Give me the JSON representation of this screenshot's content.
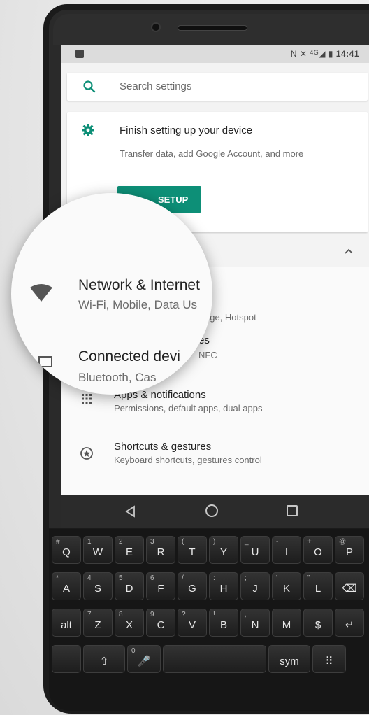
{
  "status_bar": {
    "icons": [
      "image-icon",
      "nfc-icon",
      "vibrate-icon",
      "signal-icon",
      "battery-icon"
    ],
    "network": "4G",
    "time": "14:41"
  },
  "search": {
    "placeholder": "Search settings"
  },
  "setup_card": {
    "title": "Finish setting up your device",
    "subtitle": "Transfer data, add Google Account, and more",
    "button_label": "SETUP"
  },
  "settings_items": [
    {
      "title": "Network & Internet",
      "subtitle": "Wi-Fi, Mobile, Data Usage, Hotspot",
      "visible_subtitle_tail": "age, Hotspot",
      "icon": "wifi-icon"
    },
    {
      "title": "Connected devices",
      "visible_title_tail": "es",
      "visible_subtitle_tail": "NFC",
      "icon": "devices-icon"
    },
    {
      "title": "Apps & notifications",
      "subtitle": "Permissions, default apps, dual apps",
      "icon": "apps-grid-icon"
    },
    {
      "title": "Shortcuts & gestures",
      "subtitle": "Keyboard shortcuts, gestures control",
      "icon": "shortcuts-icon"
    }
  ],
  "magnifier": {
    "title1": "Network & Internet",
    "sub1": "Wi-Fi, Mobile, Data Us",
    "title2": "Connected devi",
    "sub2": "Bluetooth, Cas"
  },
  "nav_bar": {
    "icons": [
      "back-icon",
      "home-icon",
      "recents-icon"
    ]
  },
  "keyboard": {
    "row1": [
      {
        "main": "Q",
        "alt": "#"
      },
      {
        "main": "W",
        "alt": "1"
      },
      {
        "main": "E",
        "alt": "2"
      },
      {
        "main": "R",
        "alt": "3"
      },
      {
        "main": "T",
        "alt": "("
      },
      {
        "main": "Y",
        "alt": ")"
      },
      {
        "main": "U",
        "alt": "_"
      },
      {
        "main": "I",
        "alt": "-"
      },
      {
        "main": "O",
        "alt": "+"
      },
      {
        "main": "P",
        "alt": "@"
      }
    ],
    "row2": [
      {
        "main": "A",
        "alt": "*"
      },
      {
        "main": "S",
        "alt": "4"
      },
      {
        "main": "D",
        "alt": "5"
      },
      {
        "main": "F",
        "alt": "6"
      },
      {
        "main": "G",
        "alt": "/"
      },
      {
        "main": "H",
        "alt": ":"
      },
      {
        "main": "J",
        "alt": ";"
      },
      {
        "main": "K",
        "alt": "'"
      },
      {
        "main": "L",
        "alt": "\""
      },
      {
        "main": "⌫",
        "alt": ""
      }
    ],
    "row3": [
      {
        "main": "alt",
        "alt": ""
      },
      {
        "main": "Z",
        "alt": "7"
      },
      {
        "main": "X",
        "alt": "8"
      },
      {
        "main": "C",
        "alt": "9"
      },
      {
        "main": "V",
        "alt": "?"
      },
      {
        "main": "B",
        "alt": "!"
      },
      {
        "main": "N",
        "alt": ","
      },
      {
        "main": "M",
        "alt": "."
      },
      {
        "main": "$",
        "alt": ""
      },
      {
        "main": "↵",
        "alt": ""
      }
    ],
    "row4": [
      {
        "main": "⇧",
        "alt": ""
      },
      {
        "main": "🎤",
        "alt": "0"
      },
      {
        "main": "",
        "alt": ""
      },
      {
        "main": "sym",
        "alt": ""
      },
      {
        "main": "⠿",
        "alt": ""
      }
    ]
  },
  "colors": {
    "accent": "#0d8f77",
    "screen_bg": "#f3f3f3",
    "text_primary": "#222222",
    "text_secondary": "#6a6a6a"
  }
}
